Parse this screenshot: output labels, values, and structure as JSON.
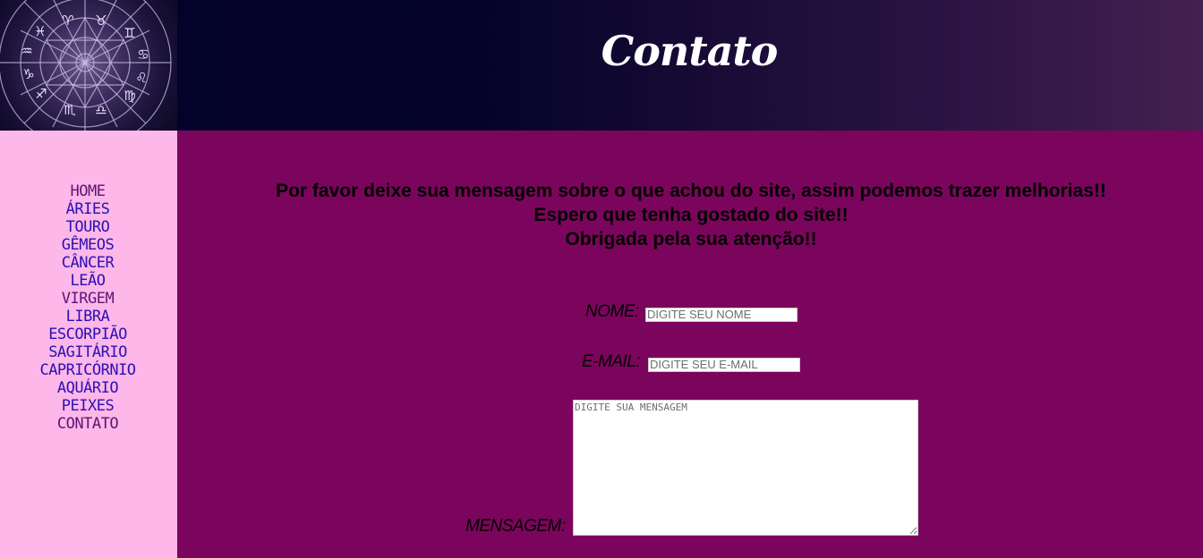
{
  "header": {
    "title": "Contato",
    "logo_icon": "zodiac-wheel-icon"
  },
  "nav": {
    "items": [
      {
        "label": "HOME",
        "state": "visited"
      },
      {
        "label": "ÁRIES",
        "state": "link"
      },
      {
        "label": "TOURO",
        "state": "link"
      },
      {
        "label": "GÊMEOS",
        "state": "link"
      },
      {
        "label": "CÂNCER",
        "state": "link"
      },
      {
        "label": "LEÃO",
        "state": "link"
      },
      {
        "label": "VIRGEM",
        "state": "visited"
      },
      {
        "label": "LIBRA",
        "state": "link"
      },
      {
        "label": "ESCORPIÃO",
        "state": "link"
      },
      {
        "label": "SAGITÁRIO",
        "state": "link"
      },
      {
        "label": "CAPRICÓRNIO",
        "state": "link"
      },
      {
        "label": "AQUÁRIO",
        "state": "link"
      },
      {
        "label": "PEIXES",
        "state": "link"
      },
      {
        "label": "CONTATO",
        "state": "visited"
      }
    ]
  },
  "intro": {
    "line1": "Por favor deixe sua mensagem sobre o que achou do site, assim podemos trazer melhorias!!",
    "line2": "Espero que tenha gostado do site!!",
    "line3": "Obrigada pela sua atenção!!"
  },
  "form": {
    "name_label": "NOME:",
    "name_placeholder": "DIGITE SEU NOME",
    "name_value": "",
    "email_label": "E-MAIL:",
    "email_placeholder": "DIGITE SEU E-MAIL",
    "email_value": "",
    "message_label": "MENSAGEM:",
    "message_placeholder": "DIGITE SUA MENSAGEM",
    "message_value": ""
  },
  "colors": {
    "header_dark": "#02012a",
    "header_light": "#44204f",
    "sidebar_bg": "#fdb7e8",
    "main_bg": "#7b055c",
    "link": "#2a11b5",
    "link_visited": "#5b1676"
  }
}
